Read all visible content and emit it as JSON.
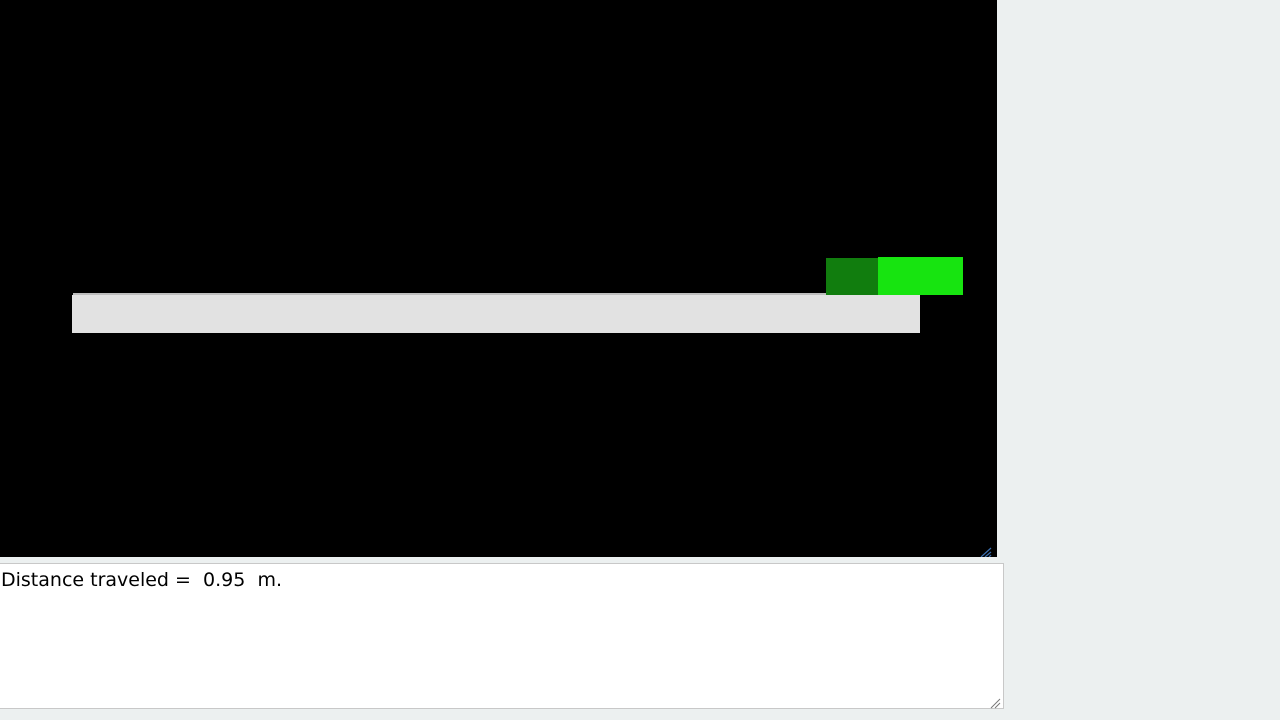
{
  "scene": {
    "background_color": "#000000",
    "platform_color": "#e2e2e2",
    "block_front_color": "#17e410",
    "block_side_color": "#117d0e"
  },
  "output": {
    "label": "Distance traveled =",
    "value": "0.95",
    "unit": "m."
  },
  "icons": {
    "canvas_resize": "resize-grip-icon",
    "output_resize": "resize-grip-icon"
  }
}
